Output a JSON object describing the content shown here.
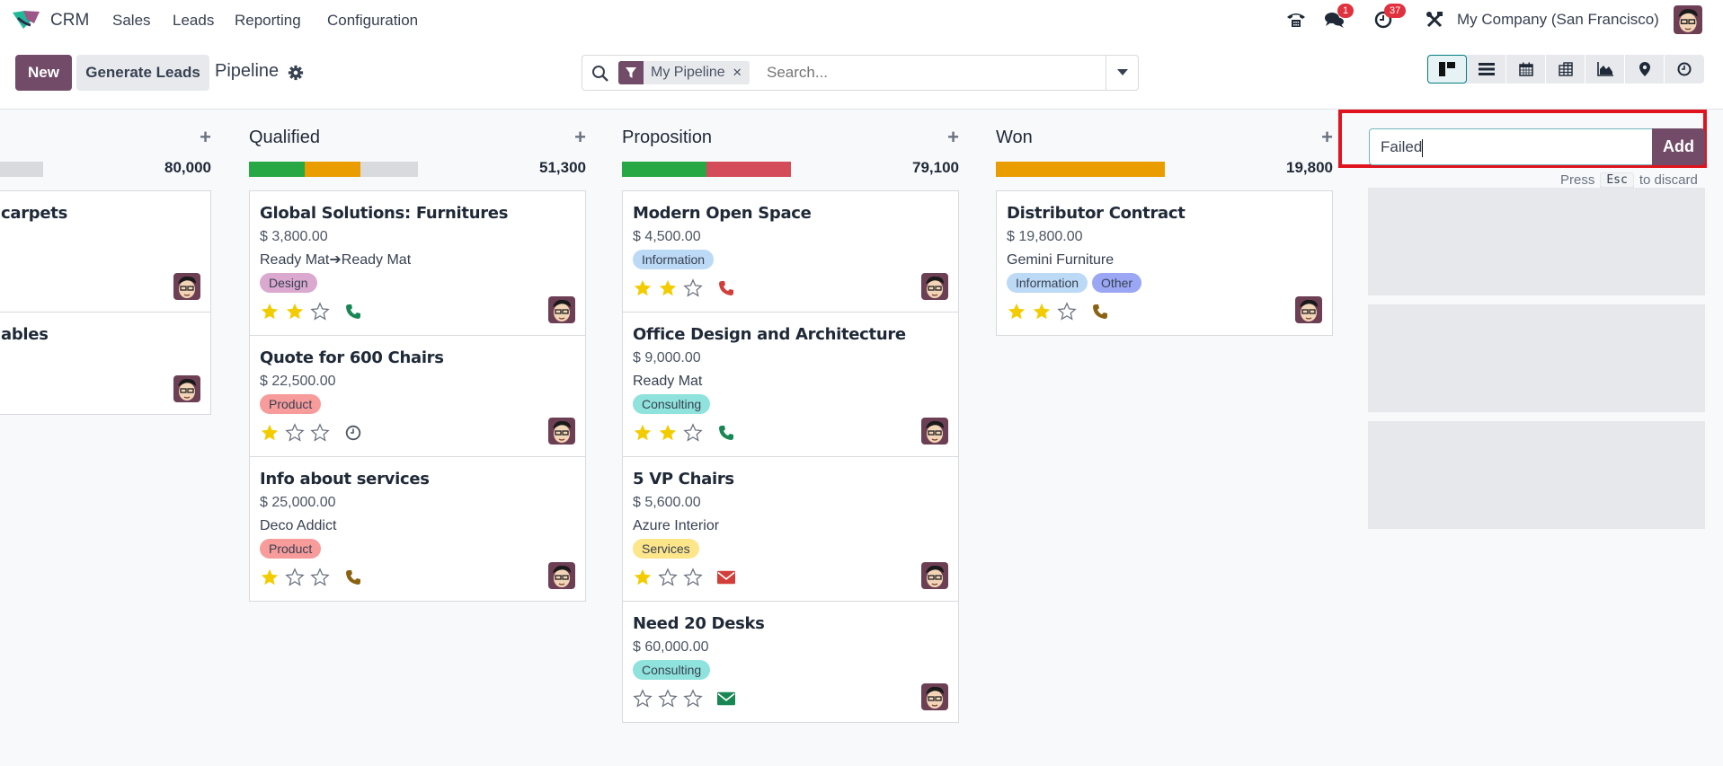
{
  "topnav": {
    "app_name": "CRM",
    "menu": [
      "Sales",
      "Leads",
      "Reporting",
      "Configuration"
    ],
    "messages_badge": "1",
    "activities_badge": "37",
    "company": "My Company (San Francisco)"
  },
  "controlbar": {
    "new_label": "New",
    "generate_label": "Generate Leads",
    "breadcrumb": "Pipeline",
    "search": {
      "facet_label": "My Pipeline",
      "placeholder": "Search..."
    },
    "views": [
      "kanban",
      "list",
      "calendar",
      "pivot",
      "graph",
      "map",
      "activity"
    ],
    "active_view": "kanban"
  },
  "colors": {
    "brand": "#714b67",
    "progress_green": "#28a745",
    "progress_orange": "#e99d00",
    "progress_red": "#d44c59",
    "progress_grey": "#d9dadd",
    "highlight_box": "#e0141e"
  },
  "columns": [
    {
      "title": "",
      "total": "80,000",
      "progress": [
        {
          "color": "#d9dadd",
          "fraction": 1.0
        }
      ],
      "cards": [
        {
          "title": "carpets",
          "amount": "",
          "partner": "",
          "tags": [],
          "stars": null,
          "activity": null
        },
        {
          "title": "ables",
          "amount": "",
          "partner": "",
          "tags": [],
          "stars": null,
          "activity": null
        }
      ]
    },
    {
      "title": "Qualified",
      "total": "51,300",
      "progress": [
        {
          "color": "#28a745",
          "fraction": 0.33
        },
        {
          "color": "#e99d00",
          "fraction": 0.33
        },
        {
          "color": "#d9dadd",
          "fraction": 0.34
        }
      ],
      "cards": [
        {
          "title": "Global Solutions: Furnitures",
          "amount": "$ 3,800.00",
          "partner": "Ready Mat➔Ready Mat",
          "tags": [
            {
              "label": "Design",
              "color": "#dba8cf"
            }
          ],
          "stars": 2,
          "activity": {
            "type": "phone",
            "color": "#198754"
          }
        },
        {
          "title": "Quote for 600 Chairs",
          "amount": "$ 22,500.00",
          "partner": "",
          "tags": [
            {
              "label": "Product",
              "color": "#f79b9b"
            }
          ],
          "stars": 1,
          "activity": {
            "type": "clock",
            "color": "#4b5563"
          }
        },
        {
          "title": "Info about services",
          "amount": "$ 25,000.00",
          "partner": "Deco Addict",
          "tags": [
            {
              "label": "Product",
              "color": "#f79b9b"
            }
          ],
          "stars": 1,
          "activity": {
            "type": "phone",
            "color": "#8a6212"
          }
        }
      ]
    },
    {
      "title": "Proposition",
      "total": "79,100",
      "progress": [
        {
          "color": "#28a745",
          "fraction": 0.5
        },
        {
          "color": "#d44c59",
          "fraction": 0.5
        }
      ],
      "cards": [
        {
          "title": "Modern Open Space",
          "amount": "$ 4,500.00",
          "partner": "",
          "tags": [
            {
              "label": "Information",
              "color": "#bcd9f6"
            }
          ],
          "stars": 2,
          "activity": {
            "type": "phone",
            "color": "#d23f3a"
          }
        },
        {
          "title": "Office Design and Architecture",
          "amount": "$ 9,000.00",
          "partner": "Ready Mat",
          "tags": [
            {
              "label": "Consulting",
              "color": "#8fe3dc"
            }
          ],
          "stars": 2,
          "activity": {
            "type": "phone",
            "color": "#198754"
          }
        },
        {
          "title": "5 VP Chairs",
          "amount": "$ 5,600.00",
          "partner": "Azure Interior",
          "tags": [
            {
              "label": "Services",
              "color": "#fde58a"
            }
          ],
          "stars": 1,
          "activity": {
            "type": "mail",
            "color": "#d23f3a"
          }
        },
        {
          "title": "Need 20 Desks",
          "amount": "$ 60,000.00",
          "partner": "",
          "tags": [
            {
              "label": "Consulting",
              "color": "#8fe3dc"
            }
          ],
          "stars": 0,
          "activity": {
            "type": "mail",
            "color": "#198754"
          }
        }
      ]
    },
    {
      "title": "Won",
      "total": "19,800",
      "progress": [
        {
          "color": "#e99d00",
          "fraction": 1.0
        }
      ],
      "cards": [
        {
          "title": "Distributor Contract",
          "amount": "$ 19,800.00",
          "partner": "Gemini Furniture",
          "tags": [
            {
              "label": "Information",
              "color": "#bcd9f6"
            },
            {
              "label": "Other",
              "color": "#9ba7f5"
            }
          ],
          "stars": 2,
          "activity": {
            "type": "phone",
            "color": "#8a6212"
          }
        }
      ]
    }
  ],
  "quick_add_stage": {
    "value": "Failed",
    "add_label": "Add",
    "hint_press": "Press",
    "hint_key": "Esc",
    "hint_suffix": "to discard"
  }
}
